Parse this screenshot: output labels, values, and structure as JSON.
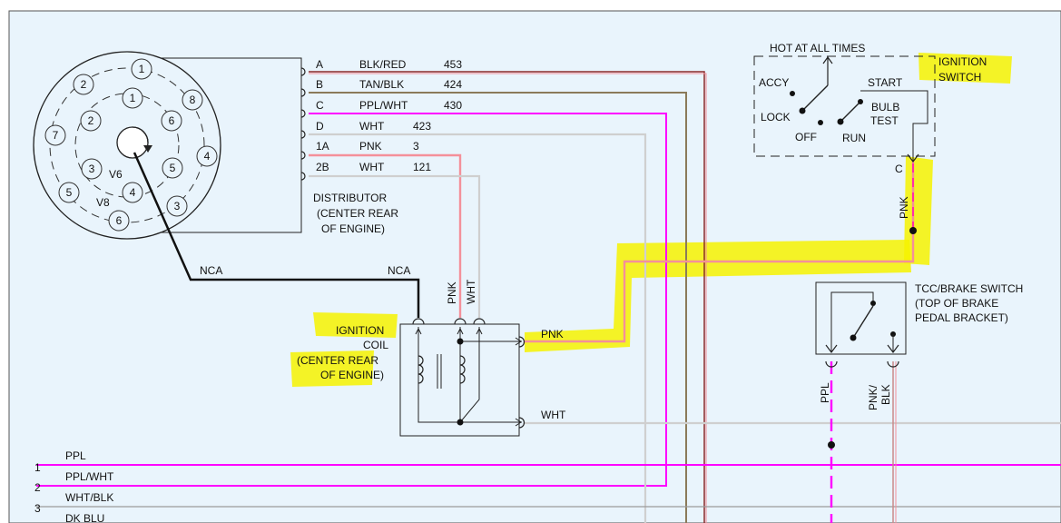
{
  "distributor": {
    "outer_cap": [
      "1",
      "8",
      "4",
      "3",
      "6",
      "5",
      "7",
      "2"
    ],
    "inner_cap": [
      "1",
      "6",
      "5",
      "4",
      "3",
      "2"
    ],
    "v6_label": "V6",
    "v8_label": "V8",
    "title": [
      "DISTRIBUTOR",
      "(CENTER REAR",
      "OF ENGINE)"
    ]
  },
  "connector_rows": [
    {
      "pin": "A",
      "color": "BLK/RED",
      "circuit": "453"
    },
    {
      "pin": "B",
      "color": "TAN/BLK",
      "circuit": "424"
    },
    {
      "pin": "C",
      "color": "PPL/WHT",
      "circuit": "430"
    },
    {
      "pin": "D",
      "color": "WHT",
      "circuit": "423"
    },
    {
      "pin": "1A",
      "color": "PNK",
      "circuit": "3"
    },
    {
      "pin": "2B",
      "color": "WHT",
      "circuit": "121"
    }
  ],
  "wire_labels": {
    "nca_left": "NCA",
    "nca_right": "NCA",
    "pnk_vertical": "PNK",
    "wht_vertical": "WHT",
    "coil_pnk_out": "PNK",
    "coil_wht_out": "WHT",
    "switch_pnk": "PNK",
    "ppl_vertical": "PPL",
    "pnk_blk_vertical": [
      "PNK/",
      "BLK"
    ]
  },
  "ignition_coil": {
    "title": [
      "IGNITION",
      "COIL",
      "(CENTER REAR",
      "OF ENGINE)"
    ]
  },
  "ignition_switch": {
    "hot_label": "HOT AT ALL TIMES",
    "title": [
      "IGNITION",
      "SWITCH"
    ],
    "positions": {
      "accy": "ACCY",
      "lock": "LOCK",
      "off": "OFF",
      "run": "RUN",
      "start": "START",
      "bulb_test": [
        "BULB",
        "TEST"
      ]
    },
    "terminal": "C"
  },
  "tcc_switch": {
    "title": [
      "TCC/BRAKE SWITCH",
      "(TOP OF BRAKE",
      "PEDAL BRACKET)"
    ]
  },
  "bus_rows": [
    {
      "num": "1",
      "label": "PPL"
    },
    {
      "num": "2",
      "label": "PPL/WHT"
    },
    {
      "num": "3",
      "label": "WHT/BLK"
    },
    {
      "num": "",
      "label": "DK BLU"
    }
  ],
  "colors": {
    "background": "#e9f4fc",
    "highlight": "#f6f200",
    "magenta": "#ff00ff",
    "pink": "#f4909a",
    "black_red": "#8a2a2a",
    "tan": "#8b7a5a",
    "white_wire": "#cfcfcf"
  }
}
